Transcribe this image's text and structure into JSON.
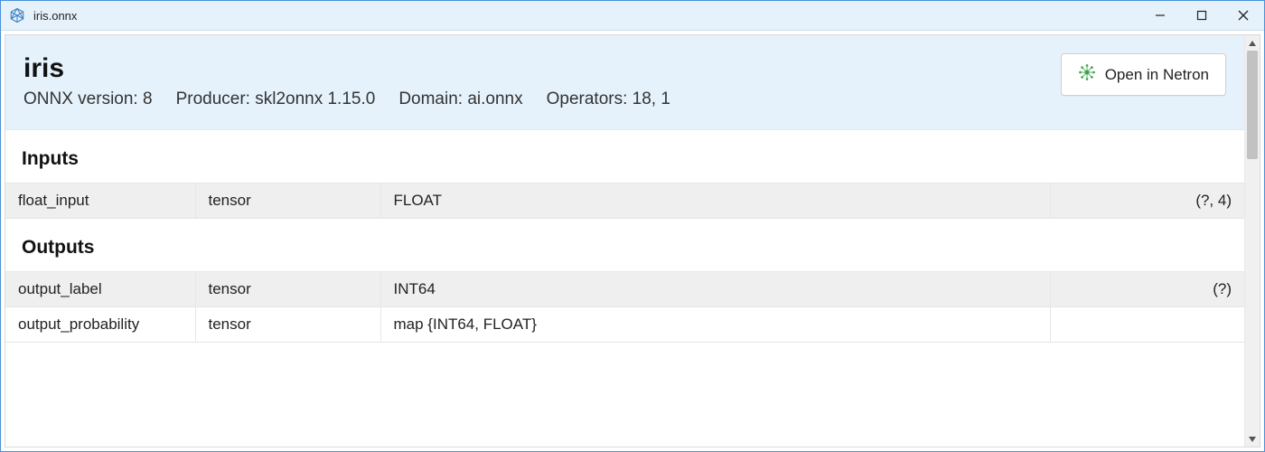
{
  "window": {
    "title": "iris.onnx"
  },
  "header": {
    "model_name": "iris",
    "onnx_version_label": "ONNX version:",
    "onnx_version": "8",
    "producer_label": "Producer:",
    "producer": "skl2onnx 1.15.0",
    "domain_label": "Domain:",
    "domain": "ai.onnx",
    "operators_label": "Operators:",
    "operators": "18, 1",
    "open_button_label": "Open in Netron"
  },
  "sections": {
    "inputs_title": "Inputs",
    "outputs_title": "Outputs"
  },
  "inputs": [
    {
      "name": "float_input",
      "kind": "tensor",
      "dtype": "FLOAT",
      "shape": "(?, 4)"
    }
  ],
  "outputs": [
    {
      "name": "output_label",
      "kind": "tensor",
      "dtype": "INT64",
      "shape": "(?)"
    },
    {
      "name": "output_probability",
      "kind": "tensor",
      "dtype": "map {INT64, FLOAT}",
      "shape": ""
    }
  ]
}
